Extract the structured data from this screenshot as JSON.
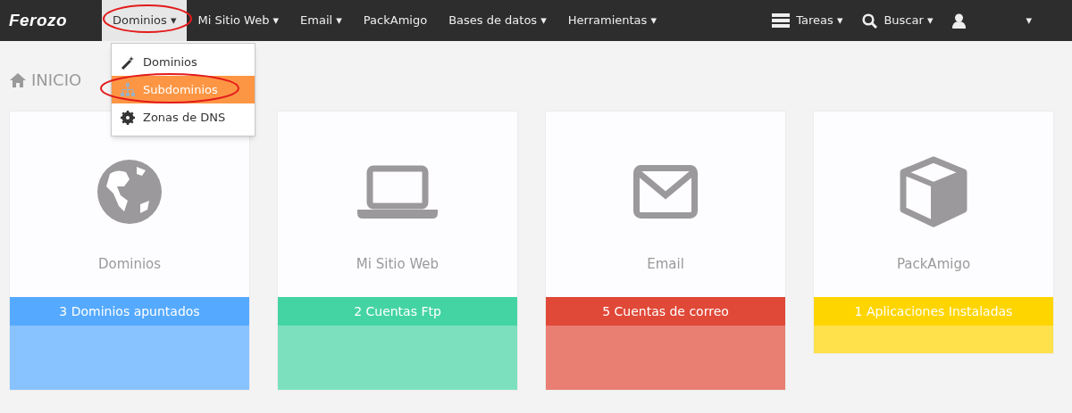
{
  "navbar": {
    "logo": "Ferozo",
    "menu": [
      {
        "label": "Dominios",
        "caret": "▾",
        "selected": true
      },
      {
        "label": "Mi Sitio Web",
        "caret": "▾",
        "selected": false
      },
      {
        "label": "Email",
        "caret": "▾",
        "selected": false
      },
      {
        "label": "PackAmigo",
        "selected": false
      },
      {
        "label": "Bases de datos",
        "caret": "▾",
        "selected": false
      },
      {
        "label": "Herramientas",
        "caret": "▾",
        "selected": false
      }
    ],
    "right": [
      {
        "kind": "tasks",
        "label": "Tareas",
        "caret": "▾"
      },
      {
        "kind": "search",
        "label": "Buscar",
        "caret": "▾"
      },
      {
        "kind": "user",
        "caret": "▾"
      }
    ]
  },
  "dropdown": {
    "items": [
      {
        "kind": "wand",
        "label": "Dominios",
        "selected": false
      },
      {
        "kind": "sitemap",
        "label": "Subdominios",
        "selected": true
      },
      {
        "kind": "gear",
        "label": "Zonas de DNS",
        "selected": false
      }
    ]
  },
  "page_title": "INICIO",
  "cards": [
    {
      "kind": "globe",
      "title": "Dominios",
      "footer": "3 Dominios apuntados",
      "color": "#55aaff",
      "tall": true
    },
    {
      "kind": "laptop",
      "title": "Mi Sitio Web",
      "footer": "2 Cuentas Ftp",
      "color": "#44d4a4",
      "tall": true
    },
    {
      "kind": "envelope",
      "title": "Email",
      "footer": "5 Cuentas de correo",
      "color": "#e04838",
      "tall": true
    },
    {
      "kind": "cube",
      "title": "PackAmigo",
      "footer": "1 Aplicaciones Instaladas",
      "color": "#ffd500",
      "tall": false
    }
  ]
}
